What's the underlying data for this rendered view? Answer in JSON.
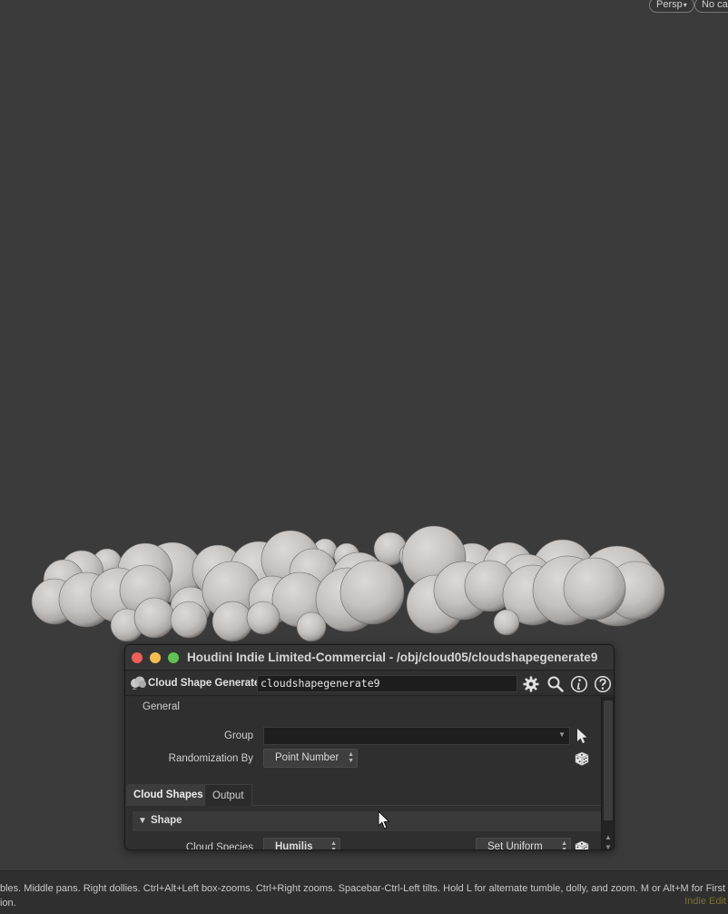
{
  "viewport": {
    "persp_label": "Persp",
    "cam_label": "No ca"
  },
  "window": {
    "title": "Houdini Indie Limited-Commercial - /obj/cloud05/cloudshapegenerate9"
  },
  "node": {
    "type_label": "Cloud Shape Generate",
    "name": "cloudshapegenerate9",
    "icons": [
      "cloud-node-icon",
      "gear-icon",
      "search-icon",
      "info-icon",
      "help-icon"
    ]
  },
  "params": {
    "general_tab": "General",
    "group_label": "Group",
    "group_value": "",
    "randomization_label": "Randomization By",
    "randomization_value": "Point Number",
    "tabs": [
      "Cloud Shapes",
      "Output"
    ],
    "shape_folder": "Shape",
    "cloud_species_label": "Cloud Species",
    "cloud_species_value": "Humilis",
    "set_uniform_value": "Set Uniform"
  },
  "status": {
    "line1": "bles. Middle pans. Right dollies. Ctrl+Alt+Left box-zooms. Ctrl+Right zooms. Spacebar-Ctrl-Left tilts. Hold L for alternate tumble, dolly, and zoom. M or Alt+M for First",
    "line2": "ion.",
    "license": "Indie Edit"
  },
  "colors": {
    "viewport_bg": "#3b3b3b",
    "cloud": "#c9c5c3",
    "close": "#ed5f57",
    "minimize": "#f3be4f",
    "maximize": "#5fc452"
  }
}
